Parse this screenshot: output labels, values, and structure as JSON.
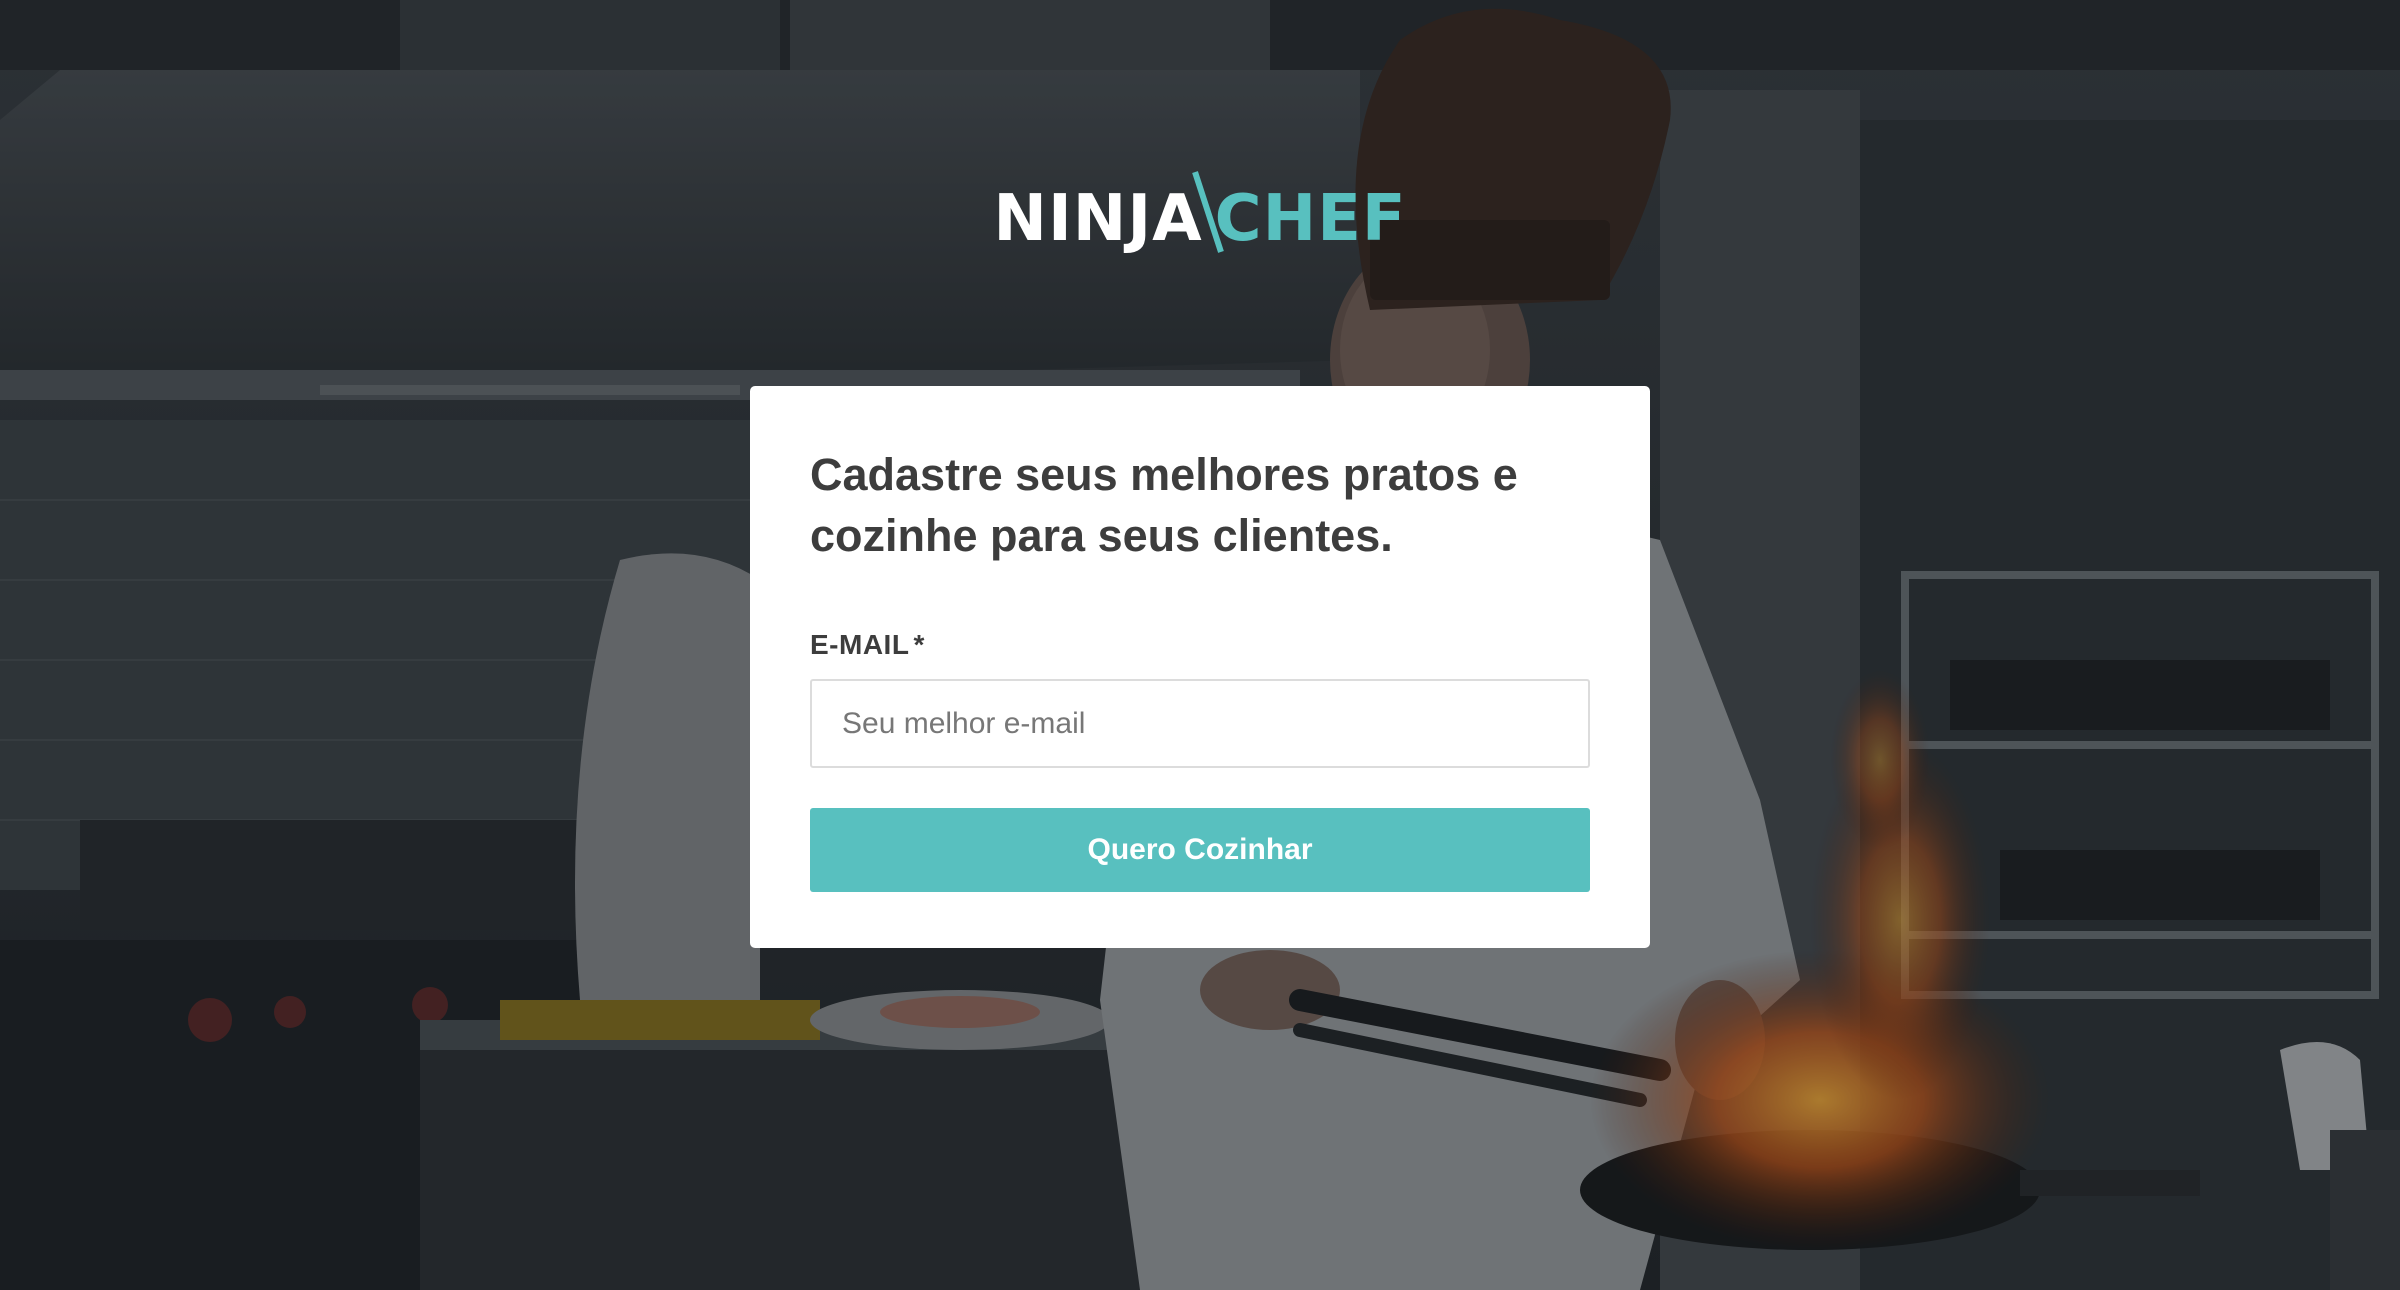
{
  "logo": {
    "part1": "NINJA",
    "part2": "CHEF",
    "accent_color": "#58c0bf"
  },
  "card": {
    "headline": "Cadastre seus melhores pratos e cozinhe para seus clientes.",
    "email_label": "E-MAIL",
    "required_marker": "*",
    "email_placeholder": "Seu melhor e-mail",
    "email_value": "",
    "submit_label": "Quero Cozinhar"
  },
  "colors": {
    "accent": "#58c0bf",
    "card_background": "#ffffff",
    "heading_text": "#3d3d3d"
  }
}
